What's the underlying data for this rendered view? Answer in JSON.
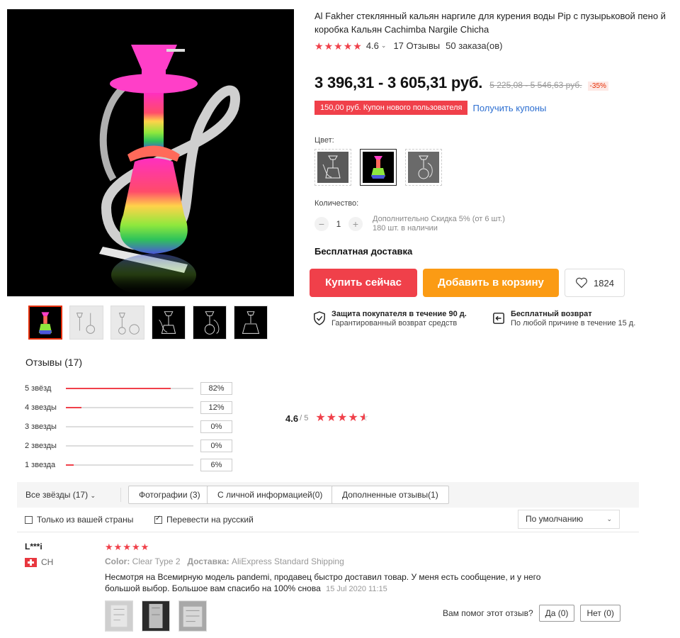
{
  "product": {
    "title": "Al Fakher стеклянный кальян наргиле для курения воды Pip с пузырьковой пено й коробка Кальян Cachimba Nargile Chicha",
    "rating": "4.6",
    "reviews_count": "17 Отзывы",
    "orders": "50 заказа(ов)",
    "price": "3 396,31 - 3 605,31 руб.",
    "old_price": "5 225,08 - 5 546,63 руб.",
    "discount": "-35%",
    "coupon": "150,00 руб. Купон нового пользователя",
    "coupon_link": "Получить купоны",
    "color_label": "Цвет:",
    "quantity_label": "Количество:",
    "quantity_value": "1",
    "quantity_minus": "−",
    "quantity_plus": "+",
    "extra_discount": "Дополнительно Скидка 5% (от 6 шт.)",
    "stock": "180 шт. в наличии",
    "free_shipping": "Бесплатная доставка",
    "buy_now": "Купить сейчас",
    "add_to_cart": "Добавить в корзину",
    "wishlist_count": "1824",
    "protection_title": "Защита покупателя в течение 90 д.",
    "protection_sub": "Гарантированный возврат средств",
    "return_title": "Бесплатный возврат",
    "return_sub": "По любой причине в течение 15 д."
  },
  "colors": {
    "accent": "#f0404a",
    "orange": "#fb9b14",
    "link": "#2d6fd1"
  },
  "reviews": {
    "heading": "Отзывы (17)",
    "distribution": [
      {
        "label": "5 звёзд",
        "pct": "82%",
        "fraction": 0.82
      },
      {
        "label": "4 звезды",
        "pct": "12%",
        "fraction": 0.12
      },
      {
        "label": "3 звезды",
        "pct": "0%",
        "fraction": 0
      },
      {
        "label": "2 звезды",
        "pct": "0%",
        "fraction": 0
      },
      {
        "label": "1 звезда",
        "pct": "6%",
        "fraction": 0.06
      }
    ],
    "average": "4.6",
    "average_of": "/ 5",
    "filters": {
      "all_stars": "Все звёзды (17)",
      "photos": "Фотографии (3)",
      "personal": "С личной информацией(0)",
      "additional": "Дополненные отзывы(1)",
      "only_country": "Только из вашей страны",
      "translate": "Перевести на русский",
      "sort": "По умолчанию"
    },
    "item": {
      "name": "L***i",
      "country": "CH",
      "color_label": "Color:",
      "color_value": "Clear Type 2",
      "shipping_label": "Доставка:",
      "shipping_value": "AliExpress Standard Shipping",
      "text": "Несмотря на Всемирную модель pandemi, продавец быстро доставил товар. У меня есть сообщение, и у него большой выбор. Большое вам спасибо на 100% снова",
      "date": "15 Jul 2020 11:15",
      "helpful_question": "Вам помог этот отзыв?",
      "yes": "Да (0)",
      "no": "Нет (0)"
    }
  }
}
